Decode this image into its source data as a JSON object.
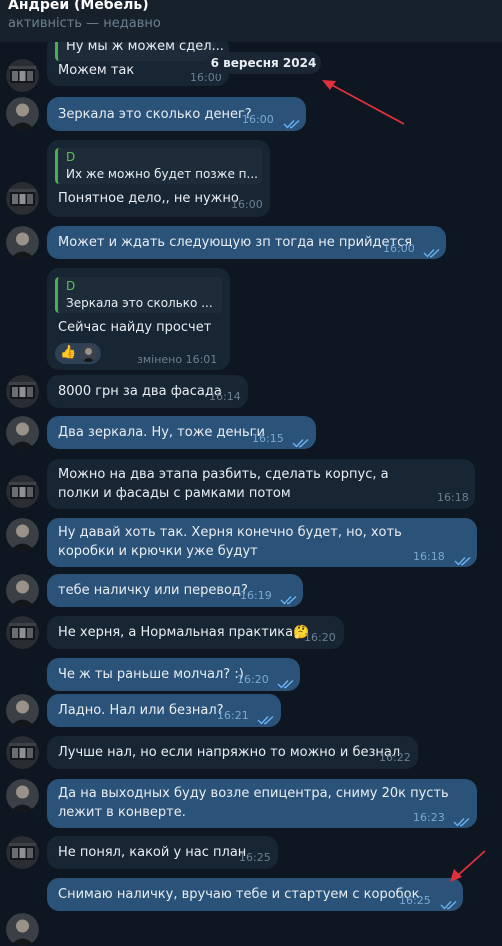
{
  "header": {
    "contact_name": "Андрей (Мебель)",
    "status": "активність — недавно"
  },
  "date_badge": "6 вересня 2024",
  "messages": [
    {
      "quote_text": "Ну мы ж можем сдел...",
      "text": "Можем так",
      "time": "16:00"
    },
    {
      "text": "Зеркала это сколько денег?",
      "time": "16:00"
    },
    {
      "quote_name": "D",
      "quote_text": "Их же можно будет позже п...",
      "text": "Понятное дело,, не нужно",
      "time": "16:00"
    },
    {
      "text": "Может и ждать следующую зп тогда не прийдется",
      "time": "16:00"
    },
    {
      "quote_name": "D",
      "quote_text": "Зеркала это сколько ...",
      "text": "Сейчас найду просчет",
      "time": "змінено 16:01",
      "reaction": "👍"
    },
    {
      "text": "8000 грн за два фасада",
      "time": "16:14"
    },
    {
      "text": "Два зеркала. Ну, тоже деньги",
      "time": "16:15"
    },
    {
      "text": "Можно на два этапа разбить, сделать корпус, а полки и фасады с рамками потом",
      "time": "16:18"
    },
    {
      "text": "Ну давай хоть так. Херня конечно будет, но, хоть коробки и крючки уже будут",
      "time": "16:18"
    },
    {
      "text": "тебе наличку или перевод?",
      "time": "16:19"
    },
    {
      "text": "Не херня, а Нормальная практика🤔",
      "time": "16:20"
    },
    {
      "text": "Че ж ты раньше молчал? :)",
      "time": "16:20"
    },
    {
      "text": "Ладно. Нал или безнал?",
      "time": "16:21"
    },
    {
      "text": "Лучше нал, но если напряжно то можно и безнал",
      "time": "16:22"
    },
    {
      "text": "Да на выходных буду возле епицентра, сниму 20к пусть лежит в конверте.",
      "time": "16:23"
    },
    {
      "text": "Не понял, какой у нас план",
      "time": "16:25"
    },
    {
      "text": "Снимаю наличку, вручаю тебе и стартуем с коробок",
      "time": "16:25"
    }
  ],
  "colors": {
    "background": "#0e1621",
    "incoming": "#182533",
    "outgoing": "#2b5278",
    "quote_accent": "#4fae4e",
    "arrow": "#e0313a"
  }
}
